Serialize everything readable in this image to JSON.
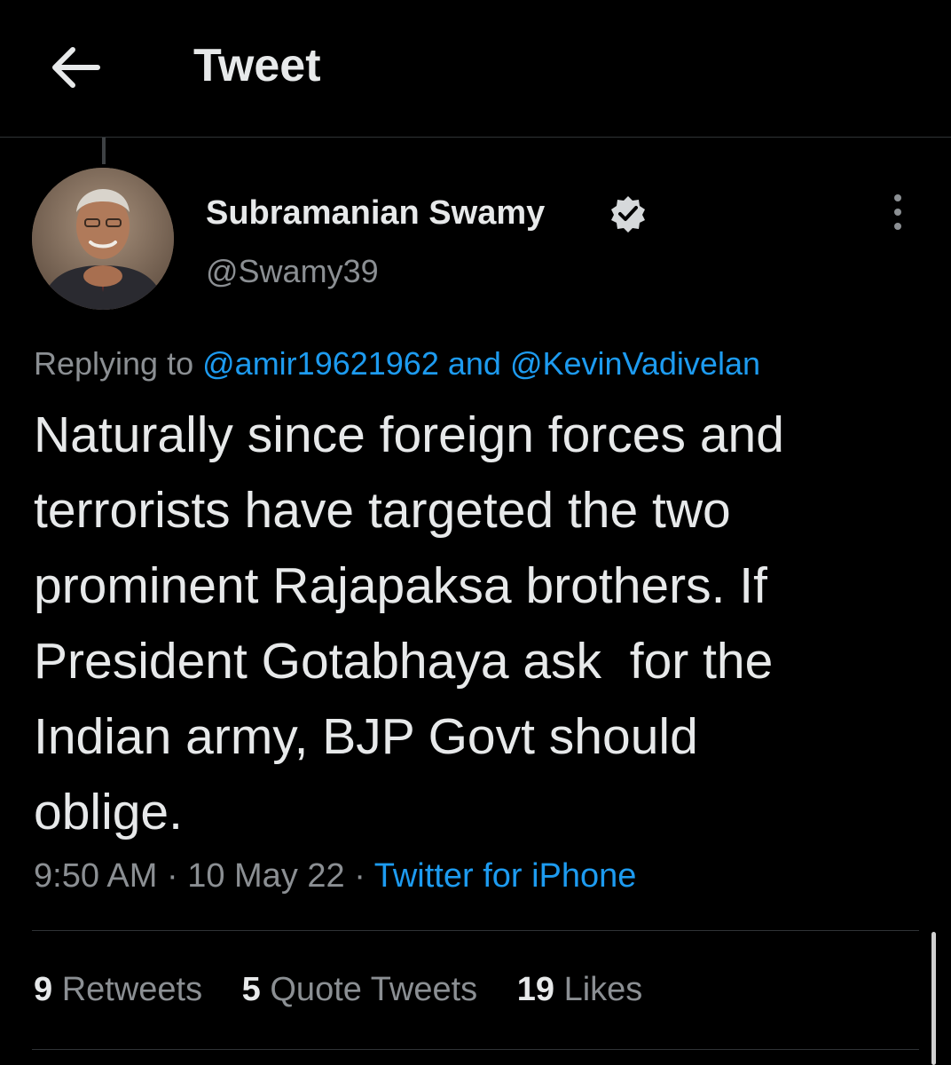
{
  "header": {
    "title": "Tweet",
    "back_icon": "arrow-left-icon"
  },
  "tweet": {
    "author": {
      "display_name": "Subramanian Swamy",
      "handle": "@Swamy39",
      "verified": true,
      "avatar_icon": "avatar-photo"
    },
    "more_icon": "more-vertical-icon",
    "reply": {
      "prefix": "Replying to",
      "mention_1": "@amir19621962",
      "conjunction": "and",
      "mention_2": "@KevinVadivelan"
    },
    "text": "Naturally since foreign forces and\nterrorists have targeted the two\nprominent Rajapaksa brothers. If\nPresident Gotabhaya ask  for the\nIndian army, BJP Govt should\noblige.",
    "time": "9:50 AM",
    "date": "10 May 22",
    "separator": "·",
    "source": "Twitter for iPhone"
  },
  "stats": {
    "retweets_count": "9",
    "retweets_label": "Retweets",
    "quotes_count": "5",
    "quotes_label": "Quote Tweets",
    "likes_count": "19",
    "likes_label": "Likes"
  },
  "colors": {
    "background": "#000000",
    "text": "#e7e9ea",
    "secondary": "#8b8f93",
    "accent": "#1d9bf0",
    "divider": "#2f3336"
  }
}
